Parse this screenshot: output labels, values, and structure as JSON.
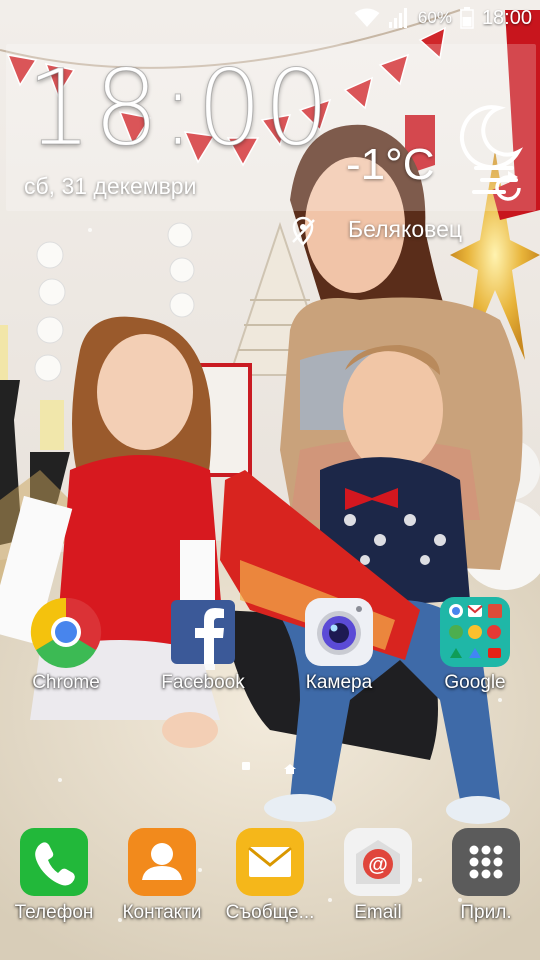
{
  "status_bar": {
    "battery_percent": "60%",
    "time": "18:00",
    "icons": [
      "wifi-icon",
      "signal-icon",
      "battery-icon"
    ]
  },
  "widget": {
    "clock": "18:00",
    "date": "сб, 31 декември",
    "temperature": "-1°C",
    "location": "Беляковец",
    "icons": [
      "moon-fog-icon",
      "location-off-icon",
      "refresh-icon"
    ]
  },
  "home_apps": [
    {
      "label": "Chrome",
      "icon": "chrome-icon"
    },
    {
      "label": "Facebook",
      "icon": "facebook-icon"
    },
    {
      "label": "Камера",
      "icon": "camera-icon"
    },
    {
      "label": "Google",
      "icon": "google-folder-icon"
    }
  ],
  "dock_apps": [
    {
      "label": "Телефон",
      "icon": "phone-icon"
    },
    {
      "label": "Контакти",
      "icon": "contacts-icon"
    },
    {
      "label": "Съобще...",
      "icon": "messages-icon"
    },
    {
      "label": "Email",
      "icon": "email-icon"
    },
    {
      "label": "Прил.",
      "icon": "apps-grid-icon"
    }
  ],
  "colors": {
    "phone_green": "#22b83a",
    "contacts_orange": "#f28a1c",
    "messages_yellow": "#f5b71a",
    "email_red": "#e0463c",
    "apps_gray": "#5b5b5b"
  }
}
